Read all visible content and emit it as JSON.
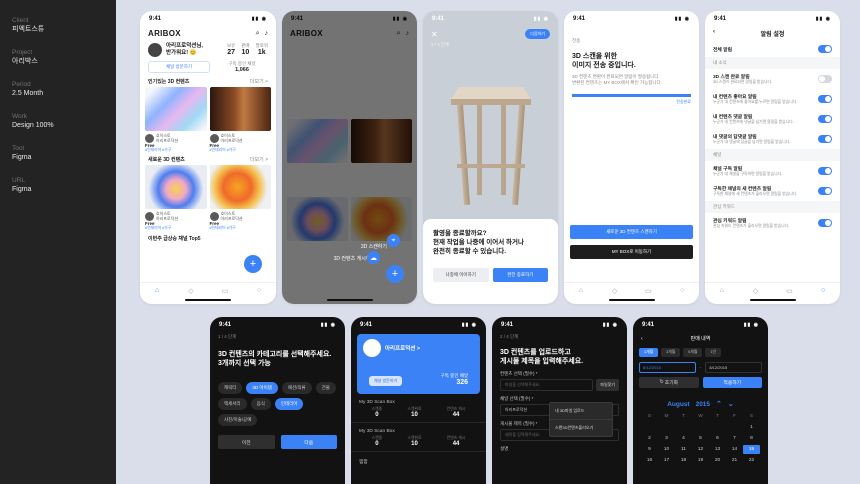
{
  "info": [
    {
      "label": "Client",
      "value": "피엑트스튜"
    },
    {
      "label": "Project",
      "value": "아리박스"
    },
    {
      "label": "Period",
      "value": "2.5 Month"
    },
    {
      "label": "Work",
      "value": "Design 100%"
    },
    {
      "label": "Tool",
      "value": "Figma"
    },
    {
      "label": "URL",
      "value": "Figma"
    }
  ],
  "status_time": "9:41",
  "home": {
    "logo": "ARIBOX",
    "greeting_line1": "아리프로덕션님,",
    "greeting_line2": "반가워요! 😊",
    "stats": [
      {
        "label": "보유",
        "value": "27"
      },
      {
        "label": "판매",
        "value": "10"
      },
      {
        "label": "팔로워",
        "value": "1k"
      }
    ],
    "channel_btn": "채널 방문하기",
    "sub_label": "구독 중인 채널",
    "sub_value": "1,066",
    "section1": "인기있는 3D 컨텐츠",
    "section2": "새로운 3D 컨텐츠",
    "section3": "이번주 급상승 채널 Top5",
    "more": "더보기 >",
    "card_author": "호이스토",
    "card_title": "아리프로덕션",
    "price": "Free",
    "tags": "#인테리어 #가구"
  },
  "menu": {
    "item1": "3D 스캔하기",
    "item2": "3D 컨텐츠 게시하기"
  },
  "stool": {
    "step": "2 / 3 단계",
    "next_btn": "다음하기",
    "question_line1": "촬영을 종료할까요?",
    "question_line2": "현재 작업을 나중에 이어서 하거나",
    "question_line3": "완전히 종료할 수 있습니다.",
    "later_btn": "나중에 이어하기",
    "finish_btn": "완전 종료하기"
  },
  "upload": {
    "step": "전송",
    "title_line1": "3D 스캔을 위한",
    "title_line2": "이미지 전송 중입니다.",
    "desc_line1": "3D 컨텐츠 변환이 완료되면 알림이 발송됩니다.",
    "desc_line2": "변환된 컨텐츠는 MY BOX에서 확인 가능합니다.",
    "progress_pct": 100,
    "progress_label": "전송완료",
    "btn_view": "새로운 3D 컨텐츠 스캔하기",
    "btn_box": "MY BOX로 이동하기"
  },
  "settings": {
    "title": "알림 설정",
    "all": "전체 알림",
    "sec_activity": "내 소식",
    "rows_activity": [
      {
        "label": "3D 스캔 완료 알림",
        "desc": "3D 스캔이 완료되면 알림을 받습니다.",
        "on": false
      },
      {
        "label": "내 컨텐츠 좋아요 알림",
        "desc": "누군가 내 컨텐츠에 좋아요를 누르면 알림을 받습니다.",
        "on": true
      },
      {
        "label": "내 컨텐츠 댓글 알림",
        "desc": "누군가 내 컨텐츠에 댓글을 남기면 알림을 받습니다.",
        "on": true
      },
      {
        "label": "내 댓글의 답댓글 알림",
        "desc": "누군가 내 댓글에 답글을 남기면 알림을 받습니다.",
        "on": true
      }
    ],
    "sec_channel": "채널",
    "rows_channel": [
      {
        "label": "채널 구독 알림",
        "desc": "누군가 내 채널을 구독하면 알림을 받습니다.",
        "on": true
      },
      {
        "label": "구독한 채널의 새 컨텐츠 알림",
        "desc": "구독한 채널에 새 컨텐츠가 올라오면 알림을 받습니다.",
        "on": true
      }
    ],
    "sec_keyword": "관심 키워드",
    "rows_keyword": [
      {
        "label": "관심 키워드 알림",
        "desc": "관심 키워드 컨텐츠가 올라오면 알림을 받습니다.",
        "on": true
      }
    ]
  },
  "category": {
    "step": "1 / 4 단계",
    "title_line1": "3D 컨텐츠의 카테고리를 선택해주세요.",
    "title_line2": "3개까지 선택 가능",
    "chips": [
      {
        "label": "캐릭터",
        "on": false
      },
      {
        "label": "3D 아이템",
        "on": true
      },
      {
        "label": "패션/의류",
        "on": false
      },
      {
        "label": "건물",
        "on": false
      },
      {
        "label": "액세서리",
        "on": false
      },
      {
        "label": "음식",
        "on": false
      },
      {
        "label": "인테리어",
        "on": true
      },
      {
        "label": "사진/미술/공예",
        "on": false
      }
    ],
    "prev_btn": "이전",
    "next_btn": "다음"
  },
  "channel": {
    "name": "아리프로덕션 >",
    "visit_btn": "채널 방문하기",
    "sub_label": "구독 중인 채널",
    "sub_value": "326",
    "boxes": [
      {
        "title": "My 3D Scan Box",
        "stats": [
          {
            "label": "스캔중",
            "value": "0"
          },
          {
            "label": "스캔완료",
            "value": "10"
          },
          {
            "label": "컨텐츠 게시",
            "value": "44"
          }
        ]
      },
      {
        "title": "My 3D Scan Box",
        "stats": [
          {
            "label": "스캔중",
            "value": "0"
          },
          {
            "label": "스캔완료",
            "value": "10"
          },
          {
            "label": "컨텐츠 게시",
            "value": "44"
          }
        ]
      }
    ],
    "footer": "찜함"
  },
  "upload_form": {
    "step": "2 / 4 단계",
    "title_line1": "3D 컨텐츠를 업로드하고",
    "title_line2": "게시물 제목을 입력해주세요.",
    "file_label": "컨텐츠 선택 (필수) *",
    "file_placeholder": "파일을 선택해주세요.",
    "file_btn": "파일찾기",
    "channel_label": "채널 선택 (필수) *",
    "channel_value": "아리프로덕션",
    "title_label": "게시물 제목 (필수) *",
    "title_placeholder": "제목을 입력해주세요.",
    "desc_label": "설명",
    "dropdown": [
      "내 3D파일 업로드",
      "스캔3D컨텐츠불러오기"
    ]
  },
  "calendar": {
    "title": "판매 내역",
    "periods": [
      {
        "label": "1개월",
        "on": true
      },
      {
        "label": "3개월",
        "on": false
      },
      {
        "label": "6개월",
        "on": false
      },
      {
        "label": "1년",
        "on": false
      }
    ],
    "date_from": "8/12/2015",
    "date_to": "8/12/2015",
    "reset_btn": "초기화",
    "apply_btn": "적용하기",
    "month": "August",
    "year": "2015",
    "dow": [
      "S",
      "M",
      "T",
      "W",
      "T",
      "F",
      "S"
    ],
    "days": [
      "",
      "",
      "",
      "",
      "",
      "",
      "1",
      "2",
      "3",
      "4",
      "5",
      "6",
      "7",
      "8",
      "9",
      "10",
      "11",
      "12",
      "13",
      "14",
      "15",
      "16",
      "17",
      "18",
      "19",
      "20",
      "21",
      "22"
    ],
    "selected": "15"
  }
}
